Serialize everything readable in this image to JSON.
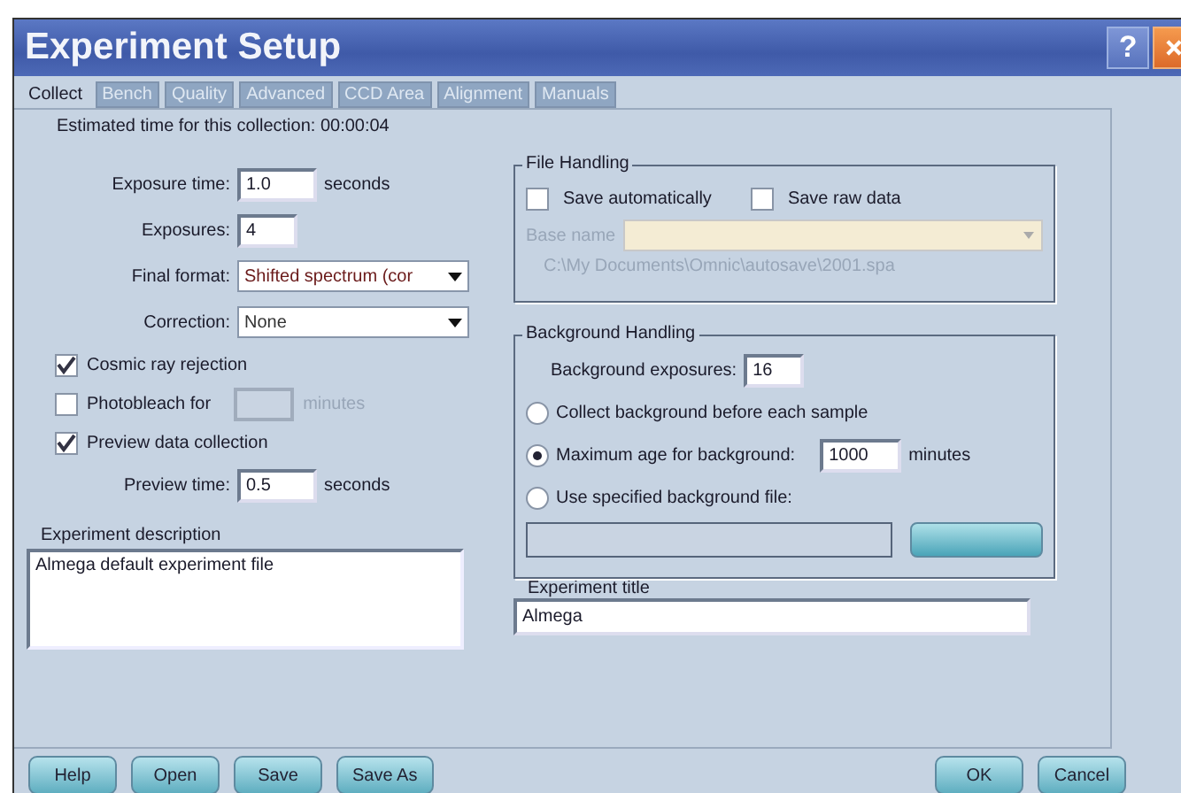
{
  "window": {
    "title": "Experiment Setup",
    "help_button": "?"
  },
  "tabs": [
    {
      "label": "Collect",
      "selected": true
    },
    {
      "label": "Bench",
      "selected": false
    },
    {
      "label": "Quality",
      "selected": false
    },
    {
      "label": "Advanced",
      "selected": false
    },
    {
      "label": "CCD Area",
      "selected": false
    },
    {
      "label": "Alignment",
      "selected": false
    },
    {
      "label": "Manuals",
      "selected": false
    }
  ],
  "estimated_time": "Estimated time for this collection: 00:00:04",
  "collect": [
    {
      "kind": "field",
      "label": "Exposure time:",
      "value": "1.0",
      "unit": "seconds"
    },
    {
      "kind": "field",
      "label": "Exposures:",
      "value": "4"
    },
    {
      "kind": "select",
      "label": "Final format:",
      "value": "Shifted spectrum (cor"
    },
    {
      "kind": "select",
      "label": "Correction:",
      "value": "None"
    },
    {
      "kind": "checkbox",
      "label": "Cosmic ray rejection",
      "checked": true
    },
    {
      "kind": "checkbox",
      "label": "Photobleach for",
      "checked": false,
      "unit": "minutes",
      "disabled": true
    },
    {
      "kind": "checkbox",
      "label": "Preview data collection",
      "checked": true
    },
    {
      "kind": "field",
      "label": "Preview time:",
      "value": "0.5",
      "unit": "seconds"
    }
  ],
  "experiment_description": {
    "label": "Experiment description",
    "value": "Almega default experiment file"
  },
  "file_handling": {
    "title": "File Handling",
    "checkboxes": [
      {
        "label": "Save automatically",
        "checked": false
      },
      {
        "label": "Save raw data",
        "checked": false
      }
    ],
    "base_name": {
      "label": "Base name",
      "disabled": true
    },
    "path": "C:\\My Documents\\Omnic\\autosave\\2001.spa"
  },
  "background_handling": {
    "title": "Background Handling",
    "exposures": {
      "label": "Background exposures:",
      "value": "16"
    },
    "options": [
      {
        "label": "Collect background before each sample",
        "selected": false
      },
      {
        "label": "Maximum age for background:",
        "selected": true,
        "value": "1000",
        "unit": "minutes"
      },
      {
        "label": "Use specified background file:",
        "selected": false
      }
    ]
  },
  "experiment_title": {
    "label": "Experiment title",
    "value": "Almega"
  },
  "buttons": [
    {
      "label": "Help",
      "kind": "left"
    },
    {
      "label": "Open",
      "kind": "left"
    },
    {
      "label": "Save",
      "kind": "left"
    },
    {
      "label": "Save As",
      "kind": "left"
    },
    {
      "label": "OK",
      "kind": "right"
    },
    {
      "label": "Cancel",
      "kind": "right"
    }
  ]
}
